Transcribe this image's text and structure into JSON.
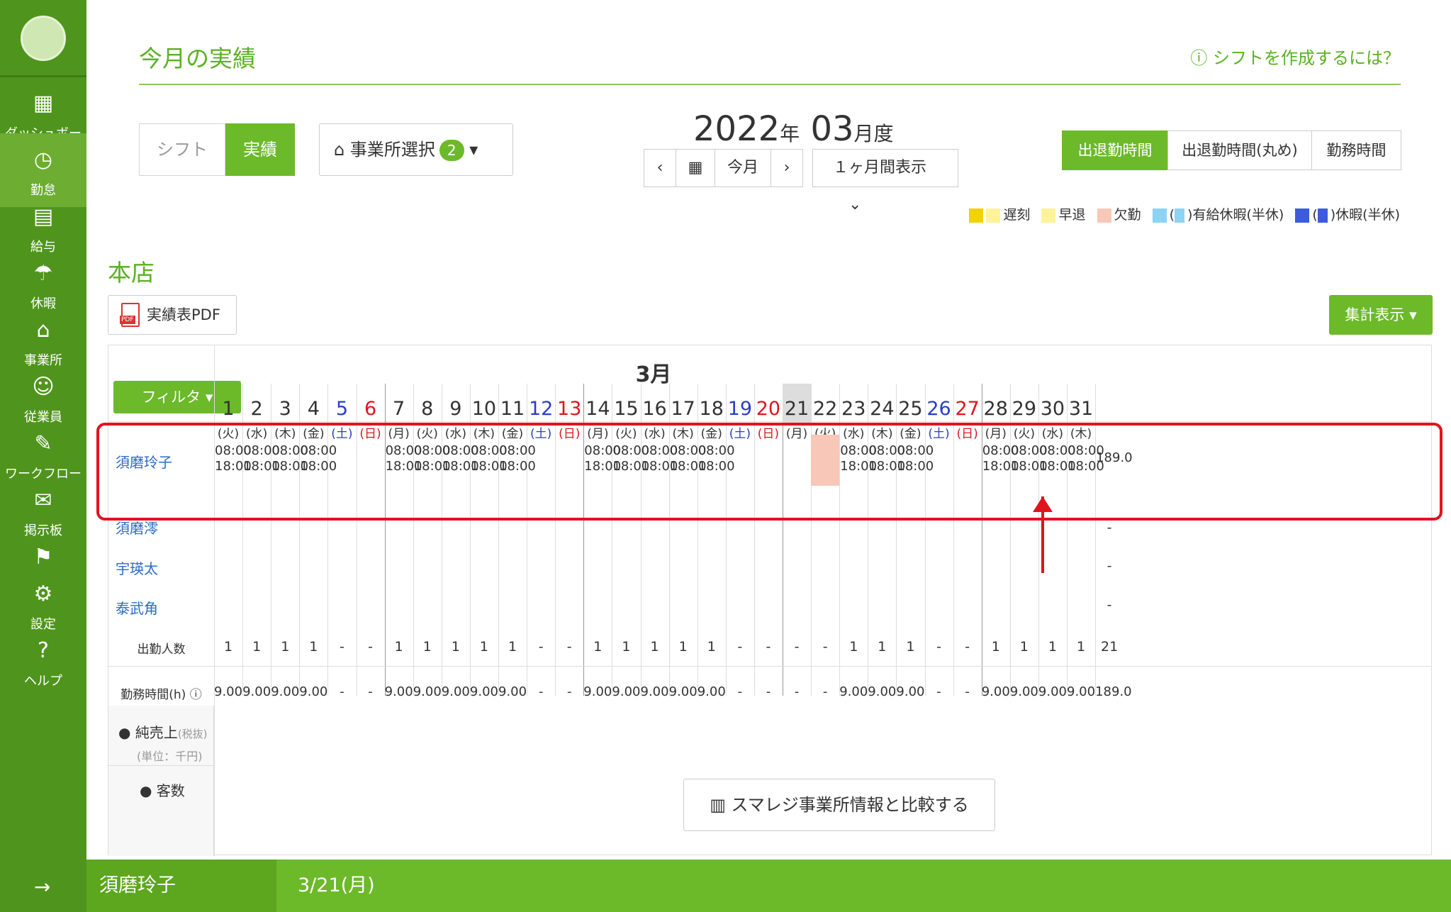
{
  "sidebar": {
    "items": [
      "ダッシュボード",
      "勤怠",
      "給与",
      "休暇",
      "事業所",
      "従業員",
      "ワークフロー",
      "掲示板",
      "",
      "設定",
      "ヘルプ"
    ]
  },
  "page": {
    "title": "今月の実績",
    "help": "シフトを作成するには？"
  },
  "tabs": {
    "shift": "シフト",
    "actual": "実績"
  },
  "shop_select": {
    "label": "事業所選択",
    "count": "2"
  },
  "period": {
    "year": "2022",
    "year_suffix": "年",
    "month": "03",
    "month_suffix": "月度",
    "today": "今月",
    "range": "１ヶ月間表示"
  },
  "modes": [
    "出退勤時間",
    "出退勤時間(丸め)",
    "勤務時間"
  ],
  "legend": [
    "遅刻",
    "早退",
    "欠勤",
    "有給休暇(半休)",
    "休暇(半休)"
  ],
  "store": {
    "name": "本店",
    "pdf": "実績表PDF",
    "summary": "集計表示",
    "filter": "フィルタ"
  },
  "calendar": {
    "month": "3月",
    "days": [
      "1",
      "2",
      "3",
      "4",
      "5",
      "6",
      "7",
      "8",
      "9",
      "10",
      "11",
      "12",
      "13",
      "14",
      "15",
      "16",
      "17",
      "18",
      "19",
      "20",
      "21",
      "22",
      "23",
      "24",
      "25",
      "26",
      "27",
      "28",
      "29",
      "30",
      "31"
    ],
    "weekdays": [
      "(火)",
      "(水)",
      "(木)",
      "(金)",
      "(土)",
      "(日)",
      "(月)",
      "(火)",
      "(水)",
      "(木)",
      "(金)",
      "(土)",
      "(日)",
      "(月)",
      "(火)",
      "(水)",
      "(木)",
      "(金)",
      "(土)",
      "(日)",
      "(月)",
      "(火)",
      "(水)",
      "(木)",
      "(金)",
      "(土)",
      "(日)",
      "(月)",
      "(火)",
      "(水)",
      "(木)"
    ]
  },
  "employees": [
    "須磨玲子",
    "須磨澪",
    "宇瑛太",
    "泰武角"
  ],
  "shift_start": "08:00",
  "shift_end": "18:00",
  "total_hours": "189.0",
  "summary": {
    "attend_label": "出勤人数",
    "attend": [
      "1",
      "1",
      "1",
      "1",
      "-",
      "-",
      "1",
      "1",
      "1",
      "1",
      "1",
      "-",
      "-",
      "1",
      "1",
      "1",
      "1",
      "1",
      "-",
      "-",
      "-",
      "-",
      "1",
      "1",
      "1",
      "-",
      "-",
      "1",
      "1",
      "1",
      "1"
    ],
    "attend_total": "21",
    "hours_label": "勤務時間(h)",
    "hours": [
      "9.00",
      "9.00",
      "9.00",
      "9.00",
      "-",
      "-",
      "9.00",
      "9.00",
      "9.00",
      "9.00",
      "9.00",
      "-",
      "-",
      "9.00",
      "9.00",
      "9.00",
      "9.00",
      "9.00",
      "-",
      "-",
      "-",
      "-",
      "9.00",
      "9.00",
      "9.00",
      "-",
      "-",
      "9.00",
      "9.00",
      "9.00",
      "9.00"
    ],
    "hours_total": "189.0"
  },
  "sales": {
    "label": "純売上",
    "tax": "(税抜)",
    "unit": "(単位：千円)",
    "customers": "客数",
    "compare": "スマレジ事業所情報と比較する"
  },
  "bottom": {
    "name": "須磨玲子",
    "date": "3/21(月)"
  }
}
